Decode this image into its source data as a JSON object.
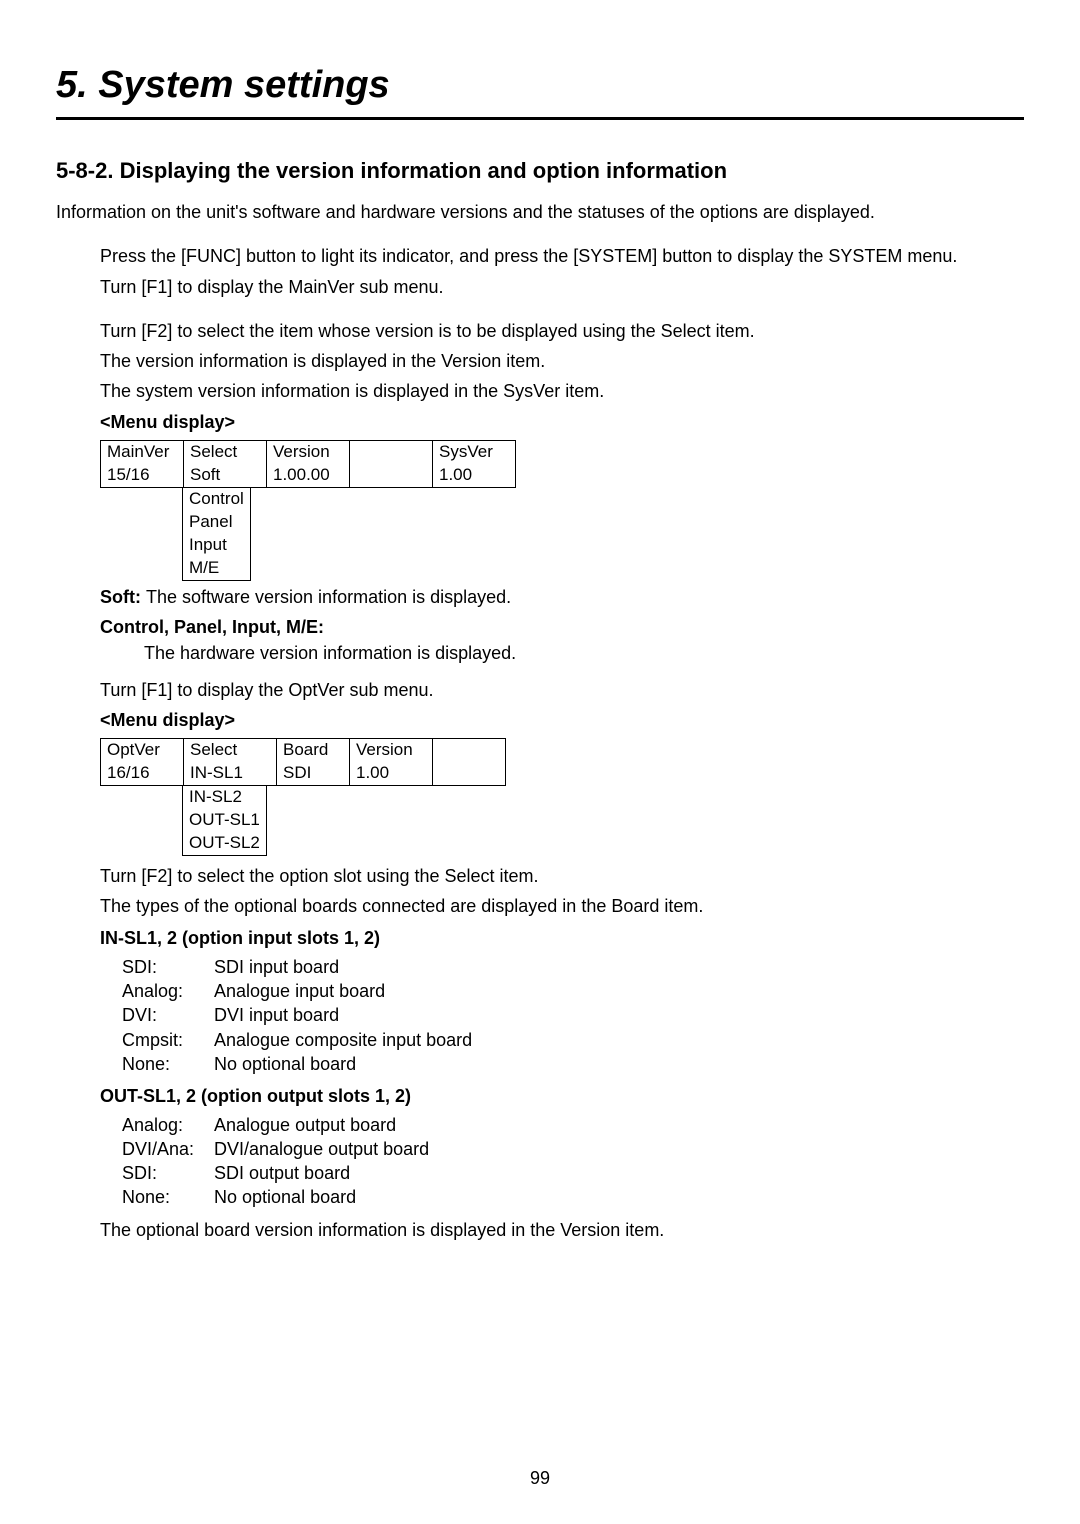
{
  "chapter_title": "5. System settings",
  "section_title": "5-8-2. Displaying the version information and option information",
  "intro": "Information on the unit's software and hardware versions and the statuses of the options are displayed.",
  "steps1": [
    "Press the [FUNC] button to light its indicator, and press the [SYSTEM] button to display the SYSTEM menu.",
    "Turn [F1] to display the MainVer sub menu.",
    "Turn [F2] to select the item whose version is to be displayed using the Select item.",
    "The version information is displayed in the Version item.",
    "The system version information is displayed in the SysVer item."
  ],
  "menu_label": "<Menu display>",
  "menu1": {
    "h1": "MainVer",
    "h2": "Select",
    "h3": "Version",
    "h4": "",
    "h5": "SysVer",
    "r1": "15/16",
    "r2": "Soft",
    "r3": "1.00.00",
    "r4": "",
    "r5": "1.00",
    "opts": [
      "Control",
      "Panel",
      "Input",
      "M/E"
    ]
  },
  "soft_label": "Soft: ",
  "soft_text": "The software version information is displayed.",
  "cpim_label": "Control, Panel, Input, M/E:",
  "cpim_text": "The hardware version information is displayed.",
  "turn_optver": "Turn [F1] to display the OptVer sub menu.",
  "menu2": {
    "h1": "OptVer",
    "h2": "Select",
    "h3": "Board",
    "h4": "Version",
    "h5": "",
    "r1": "16/16",
    "r2": "IN-SL1",
    "r3": "SDI",
    "r4": "1.00",
    "r5": "",
    "opts": [
      "IN-SL2",
      "OUT-SL1",
      "OUT-SL2"
    ]
  },
  "after_menu2_1": "Turn [F2] to select the option slot using the Select item.",
  "after_menu2_2": "The types of the optional boards connected are displayed in the Board item.",
  "insl_label": "IN-SL1, 2 (option input slots 1, 2)",
  "insl": [
    {
      "t": "SDI:",
      "d": "SDI input board"
    },
    {
      "t": "Analog:",
      "d": "Analogue input board"
    },
    {
      "t": "DVI:",
      "d": "DVI input board"
    },
    {
      "t": "Cmpsit:",
      "d": "Analogue composite input board"
    },
    {
      "t": "None:",
      "d": "No optional board"
    }
  ],
  "outsl_label": "OUT-SL1, 2 (option output slots 1, 2)",
  "outsl": [
    {
      "t": "Analog:",
      "d": "Analogue output board"
    },
    {
      "t": "DVI/Ana:",
      "d": "DVI/analogue output board"
    },
    {
      "t": "SDI:",
      "d": "SDI output board"
    },
    {
      "t": "None:",
      "d": "No optional board"
    }
  ],
  "final_line": "The optional board version information is displayed in the Version item.",
  "page_number": "99"
}
